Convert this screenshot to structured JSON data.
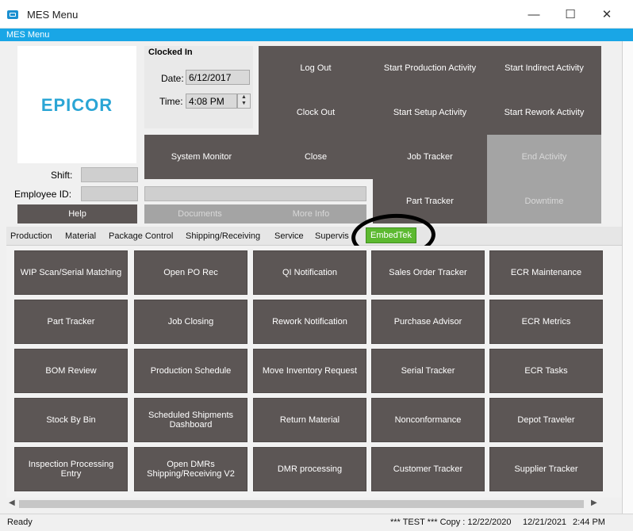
{
  "window": {
    "title": "MES Menu",
    "minimize": "—",
    "maximize": "☐",
    "close": "✕"
  },
  "menu_band": {
    "label": "MES Menu"
  },
  "logo": {
    "text": "EPICOR"
  },
  "clock": {
    "heading": "Clocked In",
    "date_label": "Date:",
    "date_value": "6/12/2017",
    "time_label": "Time:",
    "time_value": "4:08 PM"
  },
  "employee": {
    "shift_label": "Shift:",
    "employee_id_label": "Employee ID:"
  },
  "actions": {
    "log_out": "Log Out",
    "start_production": "Start Production Activity",
    "start_indirect": "Start Indirect Activity",
    "clock_out": "Clock Out",
    "start_setup": "Start Setup Activity",
    "start_rework": "Start Rework Activity",
    "system_monitor": "System Monitor",
    "close": "Close",
    "job_tracker": "Job Tracker",
    "end_activity": "End Activity",
    "part_tracker": "Part Tracker",
    "downtime": "Downtime",
    "help": "Help",
    "documents": "Documents",
    "more_info": "More Info"
  },
  "tabs": [
    {
      "label": "Production"
    },
    {
      "label": "Material"
    },
    {
      "label": "Package Control"
    },
    {
      "label": "Shipping/Receiving"
    },
    {
      "label": "Service"
    },
    {
      "label": "Supervis"
    },
    {
      "label": "EmbedTek"
    }
  ],
  "grid": [
    [
      "WIP Scan/Serial Matching",
      "Open PO Rec",
      "QI Notification",
      "Sales Order Tracker",
      "ECR Maintenance"
    ],
    [
      "Part Tracker",
      "Job Closing",
      "Rework Notification",
      "Purchase Advisor",
      "ECR Metrics"
    ],
    [
      "BOM Review",
      "Production Schedule",
      "Move Inventory Request",
      "Serial Tracker",
      "ECR Tasks"
    ],
    [
      "Stock By Bin",
      "Scheduled Shipments Dashboard",
      "Return Material",
      "Nonconformance",
      "Depot Traveler"
    ],
    [
      "Inspection Processing Entry",
      "Open DMRs Shipping/Receiving V2",
      "DMR processing",
      "Customer Tracker",
      "Supplier Tracker"
    ]
  ],
  "status": {
    "left": "Ready",
    "env": "*** TEST *** Copy : 12/22/2020",
    "date": "12/21/2021",
    "time": "2:44 PM"
  },
  "colors": {
    "accent": "#19a6e6",
    "button": "#5c5655",
    "button_disabled": "#a4a4a4",
    "active_tab": "#5cb930"
  }
}
